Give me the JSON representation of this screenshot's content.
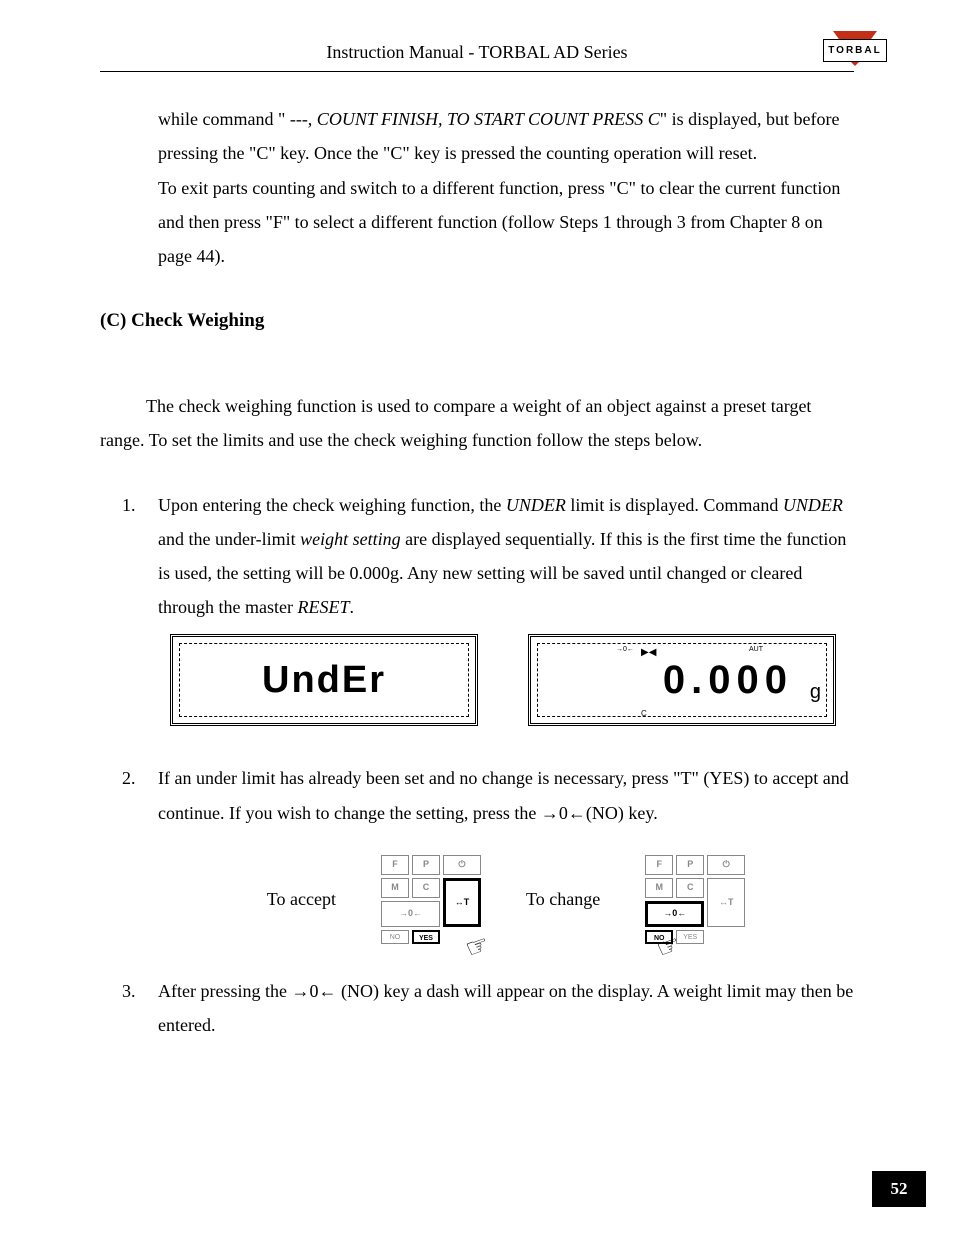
{
  "header": {
    "title": "Instruction Manual - TORBAL AD Series",
    "logo_text": "TORBAL"
  },
  "continuation_para": {
    "part1": "while command \" ",
    "italic1": "---, COUNT FINISH, TO START COUNT PRESS C",
    "part2": "\" is displayed, but before pressing the \"C\" key. Once the  \"C\" key is pressed the counting operation will reset.",
    "part3": "To exit parts counting and switch to a different function, press \"C\" to clear the current function and then press \"F\" to select a different function (follow Steps 1 through 3 from Chapter 8 on page 44)."
  },
  "section_heading": "(C)  Check Weighing",
  "intro_para": "The check weighing function is used to compare a weight of an object against a preset target range. To set the limits and use the check weighing function follow the steps below.",
  "steps": {
    "s1": {
      "p1": "Upon entering the check weighing function, the ",
      "i1": "UNDER",
      "p2": " limit is displayed.  Command ",
      "i2": "UNDER",
      "p3": " and the under-limit ",
      "i3": "weight setting",
      "p4": " are displayed sequentially. If this is the first time the function is used, the setting will be 0.000g. Any new setting will be saved until changed or cleared through the master ",
      "i4": "RESET",
      "p5": "."
    },
    "s2": "If an under limit has already been set and no change is necessary, press \"T\" (YES) to accept and continue. If you wish to change the setting, press the →0←(NO) key.",
    "s3": "After pressing the →0← (NO) key a dash will appear on the display. A weight limit may then be entered."
  },
  "lcd": {
    "left_text": "UndEr",
    "right_text": "0.000",
    "right_unit": "g",
    "right_aut": "AUT",
    "right_zero": "→0←",
    "right_tri": "▶◀",
    "right_c": "C"
  },
  "keypad": {
    "accept_label": "To accept",
    "change_label": "To change",
    "keys": {
      "f": "F",
      "p": "P",
      "pw": "⏻",
      "m": "M",
      "c": "C",
      "t": "↔T",
      "zero": "→0←",
      "no": "NO",
      "yes": "YES"
    }
  },
  "page_number": "52"
}
